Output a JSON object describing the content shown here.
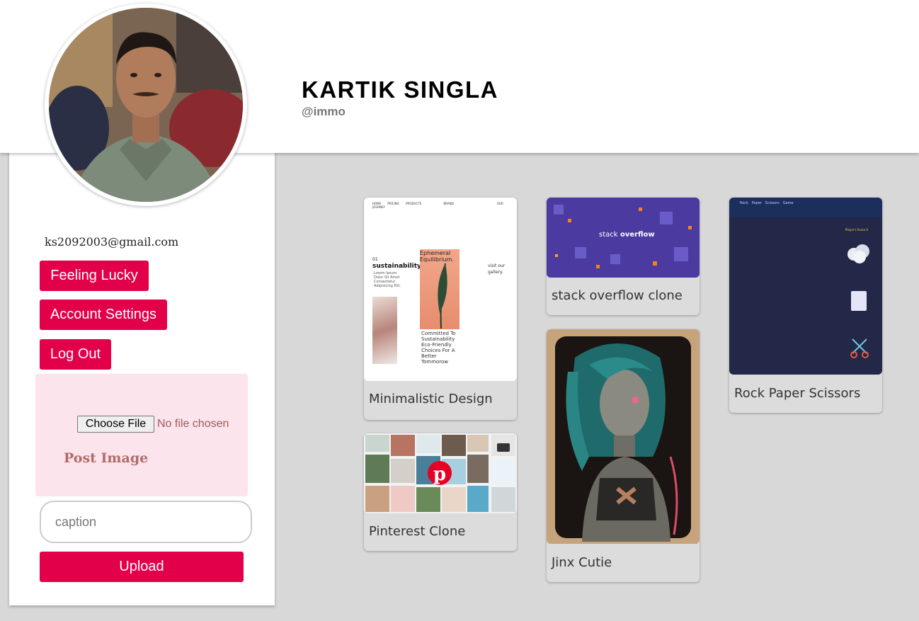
{
  "profile": {
    "name": "KARTIK SINGLA",
    "handle": "@immo",
    "email": "ks2092003@gmail.com"
  },
  "sidebar": {
    "feeling_lucky": "Feeling Lucky",
    "account_settings": "Account Settings",
    "log_out": "Log Out",
    "choose_file": "Choose File",
    "no_file": "No file chosen",
    "post_image": "Post Image",
    "caption_placeholder": "caption",
    "upload": "Upload"
  },
  "posts": [
    {
      "title": "Minimalistic Design"
    },
    {
      "title": "Pinterest Clone"
    },
    {
      "title": "stack overflow clone"
    },
    {
      "title": "Jinx Cutie"
    },
    {
      "title": "Rock Paper Scissors"
    }
  ],
  "thumb_text": {
    "design_nav": [
      "HOME",
      "PRICING",
      "PRODUCTS",
      "BRAND",
      "OUR JOURNEY"
    ],
    "design_01": "01",
    "design_heading": "sustainability",
    "design_lorem": "Lorem Ipsum Dolor Sit Amet Consectetur Adipisicing Elit.",
    "design_ephemeral": "Ephemeral Equilibrium.",
    "design_committed": "Committed To Sustainability Eco-Friendly Choices For A Better Tommorow",
    "design_visit": "visit our gallery.",
    "so_logo_stack": "stack",
    "so_logo_overflow": "overflow",
    "rps_nav": "Rock   Paper   Scissors   Game",
    "rps_score": "Player's Score 0"
  },
  "colors": {
    "accent": "#e3004a",
    "upload_bg": "#fce4ec",
    "page_bg": "#d8d8d8"
  }
}
